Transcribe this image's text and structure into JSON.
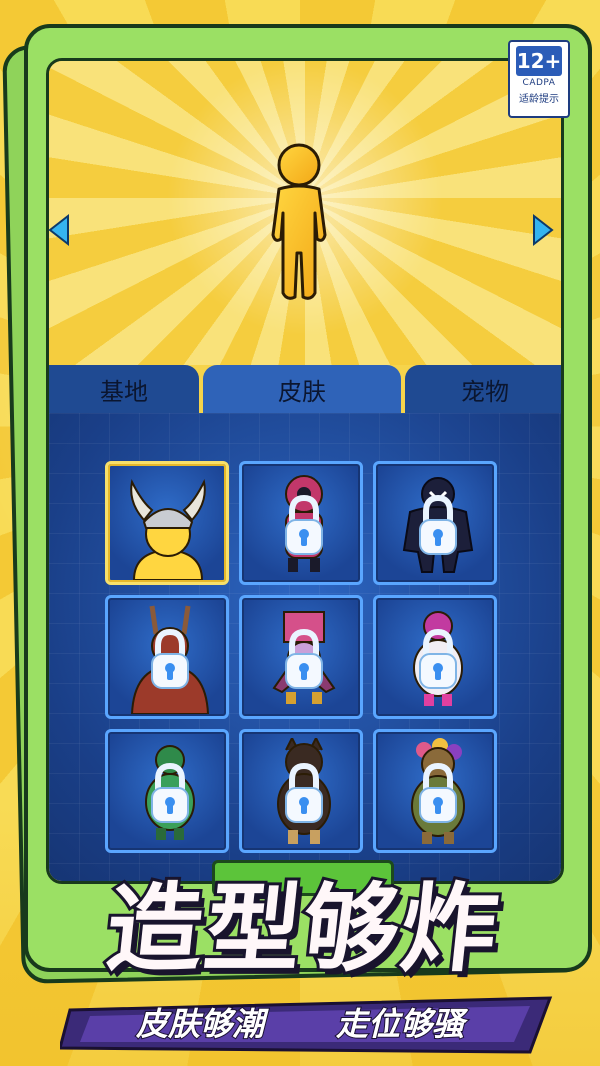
{
  "age_rating": {
    "number": "12+",
    "org": "CADPA",
    "tip": "适龄提示"
  },
  "tabs": [
    {
      "label": "基地",
      "active": false
    },
    {
      "label": "皮肤",
      "active": true
    },
    {
      "label": "宠物",
      "active": false
    }
  ],
  "skins": [
    {
      "name": "viking-helmet-skin",
      "locked": false,
      "selected": true
    },
    {
      "name": "pink-guard-skin",
      "locked": true
    },
    {
      "name": "venom-skin",
      "locked": true
    },
    {
      "name": "red-horned-skin",
      "locked": true
    },
    {
      "name": "box-head-skin",
      "locked": true
    },
    {
      "name": "pink-round-skin",
      "locked": true
    },
    {
      "name": "green-turtle-skin",
      "locked": true
    },
    {
      "name": "cat-hood-skin",
      "locked": true
    },
    {
      "name": "flower-hair-skin",
      "locked": true
    }
  ],
  "headline": "造型够炸",
  "tagline": {
    "left": "皮肤够潮",
    "right": "走位够骚"
  },
  "colors": {
    "accent_yellow": "#f6d44b",
    "panel_blue": "#1f4a92",
    "frame_green": "#9be064",
    "cell_border": "#5aa6ff"
  }
}
